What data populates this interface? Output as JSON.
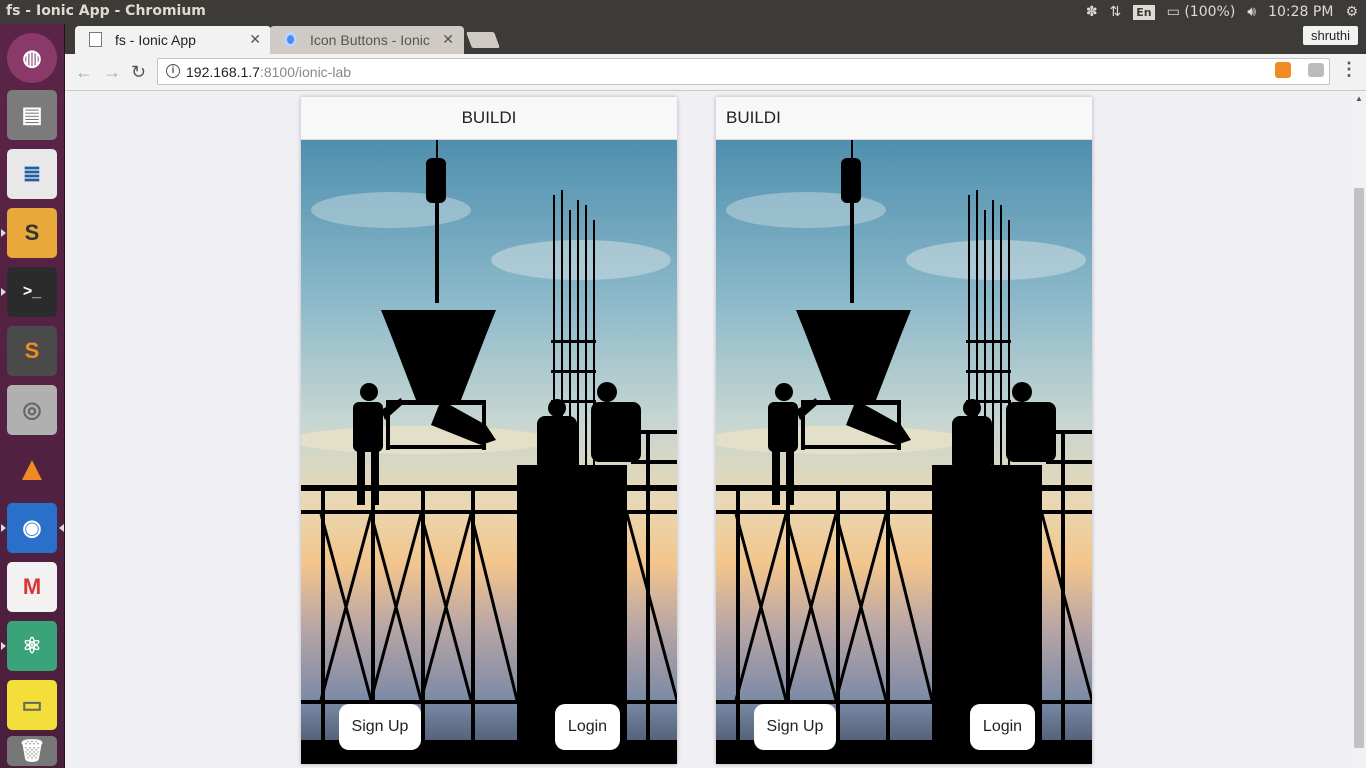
{
  "window": {
    "title": "fs - Ionic App - Chromium"
  },
  "tray": {
    "keyboard": "En",
    "battery": "(100%)",
    "time": "10:28 PM",
    "user": "shruthi"
  },
  "tabs": [
    {
      "title": "fs - Ionic App",
      "active": true
    },
    {
      "title": "Icon Buttons - Ionic",
      "active": false
    }
  ],
  "address": {
    "host": "192.168.1.7",
    "path": ":8100/ionic-lab"
  },
  "launcher": [
    "ubuntu-logo-icon",
    "files-icon",
    "writer-icon",
    "slack-icon",
    "terminal-icon",
    "sublime-icon",
    "disk-icon",
    "vlc-icon",
    "chromium-icon",
    "gmail-icon",
    "atom-icon",
    "sticky-notes-icon",
    "trash-icon"
  ],
  "devices": [
    {
      "title": "BUILDI",
      "signup": "Sign Up",
      "login": "Login"
    },
    {
      "title": "BUILDI",
      "signup": "Sign Up",
      "login": "Login"
    }
  ],
  "colors": {
    "launcher": "#5b2448",
    "topbar": "#3c3b37",
    "page_bg": "#efeff4",
    "accent": "#f08a24"
  }
}
